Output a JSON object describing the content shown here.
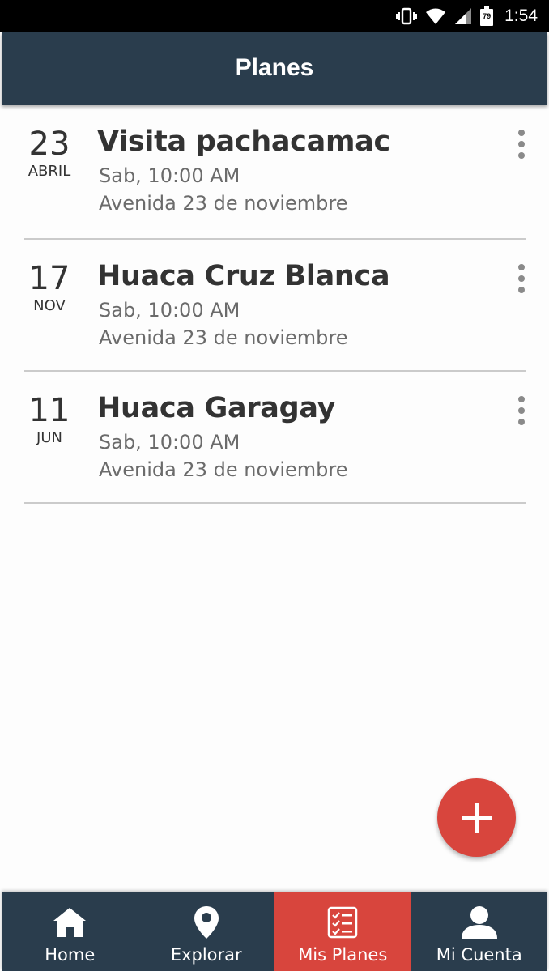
{
  "status_bar": {
    "time": "1:54",
    "battery_level": "79",
    "icons": [
      "vibrate-icon",
      "wifi-icon",
      "cell-signal-icon",
      "battery-icon"
    ]
  },
  "app_bar": {
    "title": "Planes"
  },
  "plans": [
    {
      "day": "23",
      "month": "ABRIL",
      "title": "Visita pachacamac",
      "time": "Sab, 10:00 AM",
      "address": "Avenida 23 de noviembre"
    },
    {
      "day": "17",
      "month": "NOV",
      "title": "Huaca Cruz Blanca",
      "time": "Sab, 10:00 AM",
      "address": "Avenida 23 de noviembre"
    },
    {
      "day": "11",
      "month": "JUN",
      "title": "Huaca Garagay",
      "time": "Sab, 10:00 AM",
      "address": "Avenida 23 de noviembre"
    }
  ],
  "fab": {
    "icon": "plus-icon"
  },
  "bottom_nav": {
    "active": "Mis Planes",
    "items": [
      {
        "label": "Home",
        "icon": "home-icon"
      },
      {
        "label": "Explorar",
        "icon": "location-pin-icon"
      },
      {
        "label": "Mis Planes",
        "icon": "checklist-icon"
      },
      {
        "label": "Mi Cuenta",
        "icon": "person-icon"
      }
    ]
  },
  "colors": {
    "app_bar": "#2a3d4d",
    "accent": "#d8453d",
    "background": "#fdfdfd",
    "text_primary": "#333333",
    "text_secondary": "#6b6b6b"
  }
}
